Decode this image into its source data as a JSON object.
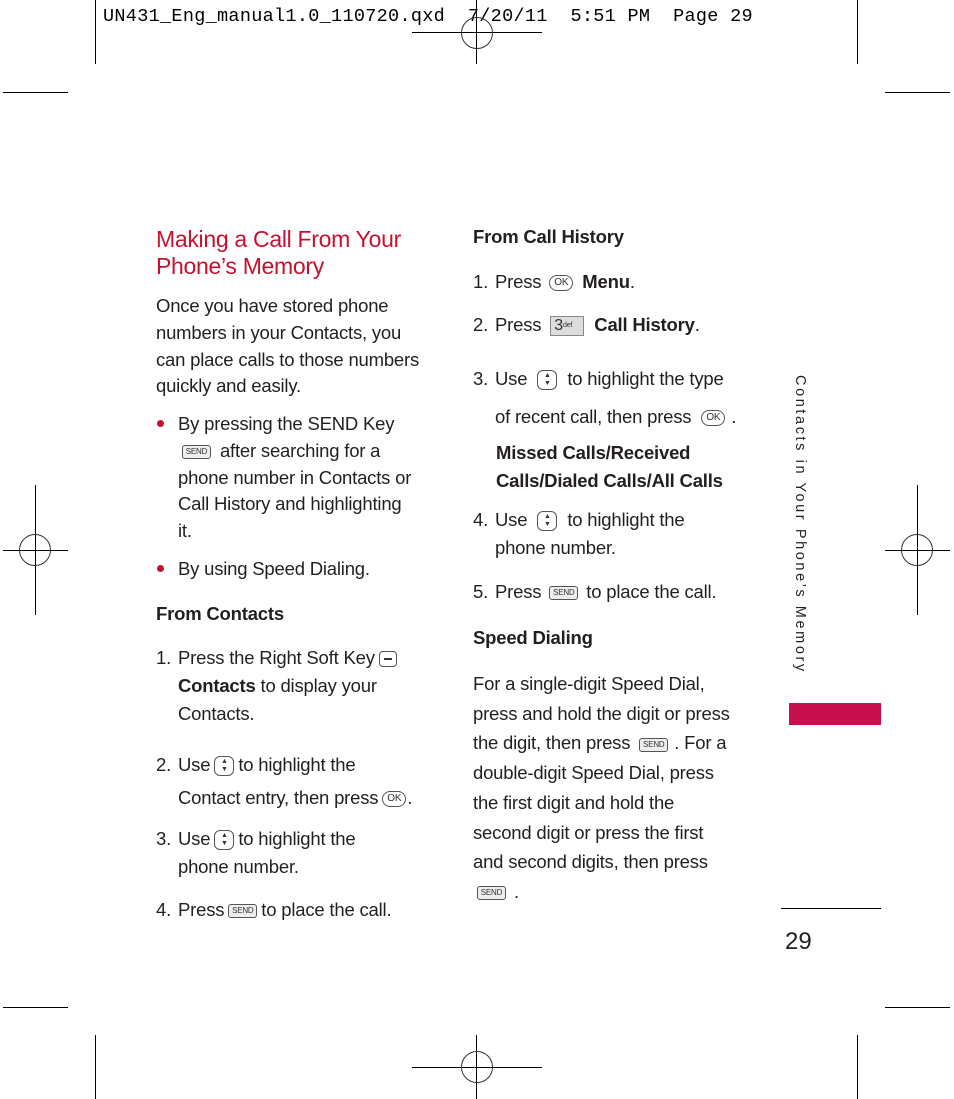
{
  "slug_line": "UN431_Eng_manual1.0_110720.qxd  7/20/11  5:51 PM  Page 29",
  "left_column": {
    "title_line1": "Making a Call From Your",
    "title_line2": "Phone’s Memory",
    "intro": [
      "Once you have stored phone",
      "numbers in your Contacts, you",
      "can place calls to those numbers",
      "quickly and easily."
    ],
    "bullet1": {
      "line1": "By pressing the SEND Key",
      "line2_after_icon": " after searching for a",
      "line3": "phone number in Contacts or",
      "line4": "Call History and highlighting",
      "line5": "it."
    },
    "bullet2": "By using Speed Dialing.",
    "from_contacts_heading": "From Contacts",
    "steps": {
      "s1_num": "1.",
      "s1_line1": "Press the Right Soft Key",
      "s1_bold": "Contacts",
      "s1_rest": " to display your",
      "s1_line3": "Contacts.",
      "s2_num": "2.",
      "s2_a": "Use",
      "s2_b": "to highlight the",
      "s2_c": "Contact entry, then press",
      "s2_d": ".",
      "s3_num": "3.",
      "s3_a": "Use",
      "s3_b": "to highlight the",
      "s3_c": "phone number.",
      "s4_num": "4.",
      "s4_a": "Press",
      "s4_b": "to place the call."
    }
  },
  "right_column": {
    "call_history_heading": "From Call History",
    "steps": {
      "s1_num": "1.",
      "s1_a": "Press",
      "s1_bold": "Menu",
      "s1_end": ".",
      "s2_num": "2.",
      "s2_a": "Press",
      "s2_bold": "Call History",
      "s2_end": ".",
      "s3_num": "3.",
      "s3_a": "Use",
      "s3_b": "to highlight the type",
      "s3_c": "of recent call, then press",
      "s3_d": ".",
      "s3_options_line1": "Missed Calls/Received",
      "s3_options_line2": "Calls/Dialed Calls/All Calls",
      "s4_num": "4.",
      "s4_a": "Use",
      "s4_b": "to highlight the",
      "s4_c": "phone number.",
      "s5_num": "5.",
      "s5_a": "Press",
      "s5_b": "to place the call."
    },
    "speed_heading": "Speed Dialing",
    "speed_lines": {
      "l1": "For a single-digit Speed Dial,",
      "l2": "press and hold the digit or press",
      "l3a": "the digit, then press",
      "l3b": ". For a",
      "l4": "double-digit Speed Dial, press",
      "l5": "the first digit and hold the",
      "l6": "second digit or press the first",
      "l7": "and second digits, then press",
      "l8": "."
    }
  },
  "keys": {
    "send": "SEND",
    "ok": "OK",
    "nav": "▲\n▼",
    "three": "3",
    "three_sub": "def"
  },
  "side_tab": {
    "label": "Contacts in Your Phone’s Memory",
    "color": "#c8104f"
  },
  "page_number": "29",
  "colors": {
    "accent": "#c8102e",
    "text": "#231f20"
  }
}
